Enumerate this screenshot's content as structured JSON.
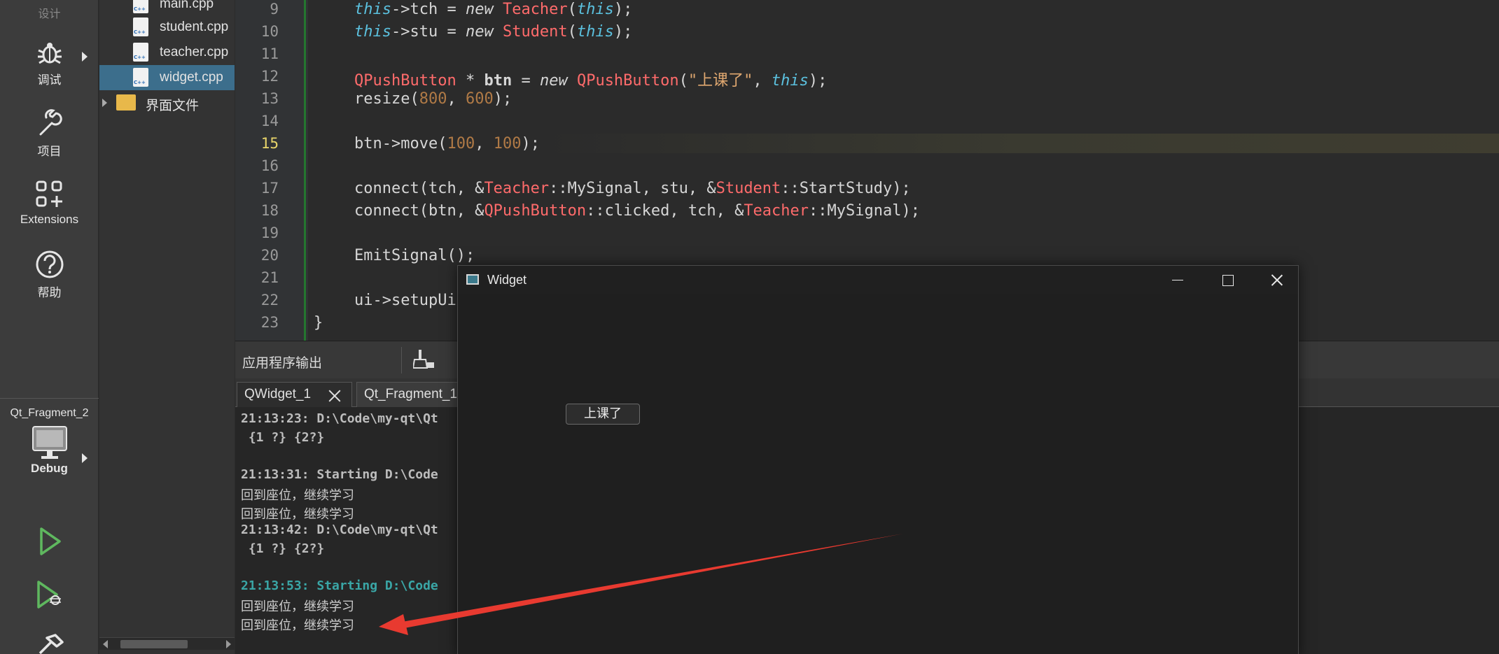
{
  "modebar": {
    "design_label": "设计",
    "debug_label": "调试",
    "project_label": "项目",
    "extensions_label": "Extensions",
    "help_label": "帮助",
    "kit_project": "Qt_Fragment_2",
    "kit_build": "Debug"
  },
  "tree": {
    "files": [
      "main.cpp",
      "student.cpp",
      "teacher.cpp",
      "widget.cpp"
    ],
    "selected": "widget.cpp",
    "folder": "界面文件"
  },
  "editor": {
    "current_line": 15,
    "lines": [
      {
        "n": "9",
        "parts": [
          [
            "kw-this",
            "this"
          ],
          [
            "",
            "->tch = "
          ],
          [
            "kw-new",
            "new"
          ],
          [
            "",
            " "
          ],
          [
            "cls",
            "Teacher"
          ],
          [
            "",
            "("
          ],
          [
            "kw-this",
            "this"
          ],
          [
            "",
            ");"
          ]
        ]
      },
      {
        "n": "10",
        "parts": [
          [
            "kw-this",
            "this"
          ],
          [
            "",
            "->stu = "
          ],
          [
            "kw-new",
            "new"
          ],
          [
            "",
            " "
          ],
          [
            "cls",
            "Student"
          ],
          [
            "",
            "("
          ],
          [
            "kw-this",
            "this"
          ],
          [
            "",
            ");"
          ]
        ]
      },
      {
        "n": "11",
        "parts": []
      },
      {
        "n": "12",
        "parts": [
          [
            "cls",
            "QPushButton"
          ],
          [
            "",
            " * "
          ],
          [
            "bold",
            "btn"
          ],
          [
            "",
            " = "
          ],
          [
            "kw-new",
            "new"
          ],
          [
            "",
            " "
          ],
          [
            "cls",
            "QPushButton"
          ],
          [
            "",
            "("
          ],
          [
            "str",
            "\"上课了\""
          ],
          [
            "",
            ", "
          ],
          [
            "kw-this",
            "this"
          ],
          [
            "",
            ");"
          ]
        ]
      },
      {
        "n": "13",
        "parts": [
          [
            "",
            "resize("
          ],
          [
            "num",
            "800"
          ],
          [
            "",
            ", "
          ],
          [
            "num",
            "600"
          ],
          [
            "",
            ");"
          ]
        ]
      },
      {
        "n": "14",
        "parts": []
      },
      {
        "n": "15",
        "parts": [
          [
            "",
            "btn->move("
          ],
          [
            "num",
            "100"
          ],
          [
            "",
            ", "
          ],
          [
            "num",
            "100"
          ],
          [
            "",
            ");"
          ]
        ]
      },
      {
        "n": "16",
        "parts": []
      },
      {
        "n": "17",
        "parts": [
          [
            "",
            "connect(tch, &"
          ],
          [
            "cls",
            "Teacher"
          ],
          [
            "",
            "::MySignal, stu, &"
          ],
          [
            "cls",
            "Student"
          ],
          [
            "",
            "::StartStudy);"
          ]
        ]
      },
      {
        "n": "18",
        "parts": [
          [
            "",
            "connect(btn, &"
          ],
          [
            "cls",
            "QPushButton"
          ],
          [
            "",
            "::clicked, tch, &"
          ],
          [
            "cls",
            "Teacher"
          ],
          [
            "",
            "::MySignal);"
          ]
        ]
      },
      {
        "n": "19",
        "parts": []
      },
      {
        "n": "20",
        "parts": [
          [
            "",
            "EmitSignal();"
          ]
        ]
      },
      {
        "n": "21",
        "parts": []
      },
      {
        "n": "22",
        "parts": [
          [
            "",
            "ui->setupUi"
          ]
        ]
      },
      {
        "n": "23",
        "parts": [
          [
            "brace",
            "}"
          ]
        ]
      }
    ]
  },
  "output": {
    "title": "应用程序输出",
    "tabs": [
      "QWidget_1",
      "Qt_Fragment_1"
    ],
    "lines": [
      {
        "style": "b",
        "text": "21:13:23: D:\\Code\\my-qt\\Qt"
      },
      {
        "style": "b",
        "text": " {1 ?} {2?}"
      },
      {
        "style": "",
        "text": ""
      },
      {
        "style": "b",
        "text": "21:13:31: Starting D:\\Code"
      },
      {
        "style": "zh",
        "text": "回到座位，继续学习"
      },
      {
        "style": "zh",
        "text": "回到座位，继续学习"
      },
      {
        "style": "b",
        "text": "21:13:42: D:\\Code\\my-qt\\Qt"
      },
      {
        "style": "b",
        "text": " {1 ?} {2?}"
      },
      {
        "style": "",
        "text": ""
      },
      {
        "style": "teal",
        "text": "21:13:53: Starting D:\\Code"
      },
      {
        "style": "zh",
        "text": "回到座位，继续学习"
      },
      {
        "style": "zh",
        "text": "回到座位，继续学习"
      }
    ]
  },
  "widget_window": {
    "title": "Widget",
    "button_label": "上课了"
  },
  "annotation": {
    "arrow_color": "#e83a30"
  }
}
